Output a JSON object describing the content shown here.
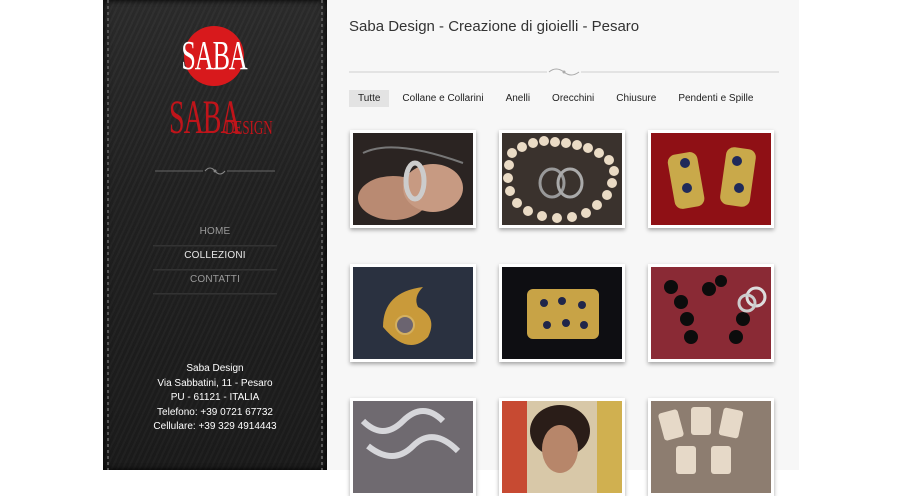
{
  "logo": {
    "circle_text": "SABA",
    "word": "SABA",
    "sub": "DESIGN"
  },
  "nav": {
    "home": "HOME",
    "collezioni": "COLLEZIONI",
    "contatti": "CONTATTI"
  },
  "address": {
    "line1": "Saba Design",
    "line2": "Via Sabbatini, 11 - Pesaro",
    "line3": "PU - 61121 - ITALIA",
    "line4": "Telefono: +39 0721 67732",
    "line5": "Cellulare: +39 329 4914443"
  },
  "main": {
    "title": "Saba Design - Creazione di gioielli - Pesaro"
  },
  "tabs": [
    "Tutte",
    "Collane e Collarini",
    "Anelli",
    "Orecchini",
    "Chiusure",
    "Pendenti e Spille"
  ],
  "colors": {
    "brand_red": "#d8191c",
    "sidebar_dark": "#222222",
    "main_bg": "#f7f7f7"
  }
}
